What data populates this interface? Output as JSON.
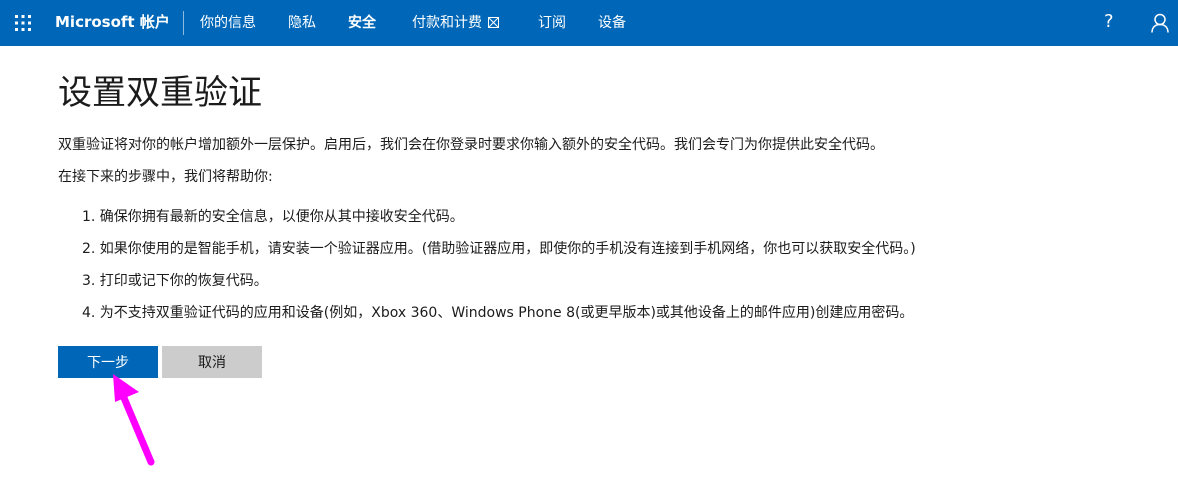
{
  "header": {
    "brand": "Microsoft 帐户",
    "nav": [
      {
        "label": "你的信息",
        "active": false
      },
      {
        "label": "隐私",
        "active": false
      },
      {
        "label": "安全",
        "active": true
      },
      {
        "label": "付款和计费",
        "active": false,
        "external": true
      },
      {
        "label": "订阅",
        "active": false
      },
      {
        "label": "设备",
        "active": false
      }
    ],
    "help_symbol": "?",
    "icons": {
      "left": "app-launcher-icon",
      "right": "account-icon"
    },
    "bg_color": "#0067b8"
  },
  "main": {
    "title": "设置双重验证",
    "intro": "双重验证将对你的帐户增加额外一层保护。启用后，我们会在你登录时要求你输入额外的安全代码。我们会专门为你提供此安全代码。",
    "lead": "在接下来的步骤中，我们将帮助你:",
    "steps": [
      "1. 确保你拥有最新的安全信息，以便你从其中接收安全代码。",
      "2. 如果你使用的是智能手机，请安装一个验证器应用。(借助验证器应用，即使你的手机没有连接到手机网络，你也可以获取安全代码。)",
      "3. 打印或记下你的恢复代码。",
      "4. 为不支持双重验证代码的应用和设备(例如，Xbox 360、Windows Phone 8(或更早版本)或其他设备上的邮件应用)创建应用密码。"
    ],
    "next_button": "下一步",
    "cancel_button": "取消"
  },
  "annotation": {
    "color": "#ff00ff",
    "icon": "pointer-arrow-icon"
  }
}
